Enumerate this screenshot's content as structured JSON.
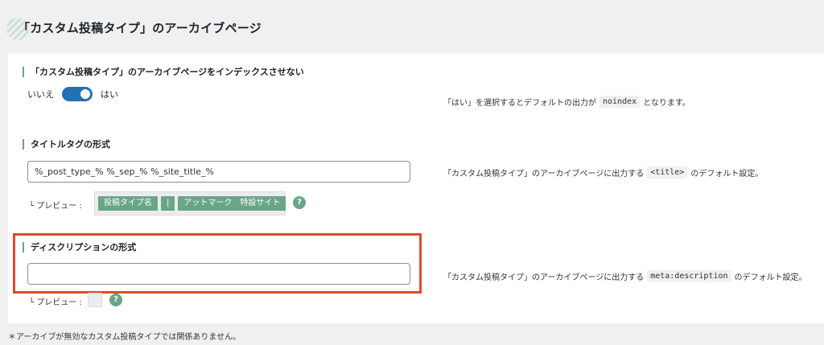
{
  "page": {
    "title": "「カスタム投稿タイプ」のアーカイブページ"
  },
  "noindex": {
    "title": "「カスタム投稿タイプ」のアーカイブページをインデックスさせない",
    "off_label": "いいえ",
    "on_label": "はい",
    "toggle_on": true,
    "desc_before": "「はい」を選択するとデフォルトの出力が",
    "desc_code": "noindex",
    "desc_after": "となります。"
  },
  "title_tag": {
    "title": "タイトルタグの形式",
    "value": "%_post_type_% %_sep_% %_site_title_%",
    "preview_label": "└ プレビュー :",
    "chips": [
      "投稿タイプ名",
      "|",
      "アットマーク　特設サイト"
    ],
    "desc_before": "「カスタム投稿タイプ」のアーカイブページに出力する",
    "desc_code": "<title>",
    "desc_after": "のデフォルト設定。"
  },
  "description": {
    "title": "ディスクリプションの形式",
    "value": "",
    "preview_label": "└ プレビュー :",
    "desc_before": "「カスタム投稿タイプ」のアーカイブページに出力する",
    "desc_code": "meta:description",
    "desc_after": "のデフォルト設定。"
  },
  "help_glyph": "?",
  "footnote": "＊アーカイブが無効なカスタム投稿タイプでは関係ありません。",
  "colors": {
    "accent": "#6aa587",
    "toggle": "#2271b1",
    "highlight": "#e04a2a"
  }
}
